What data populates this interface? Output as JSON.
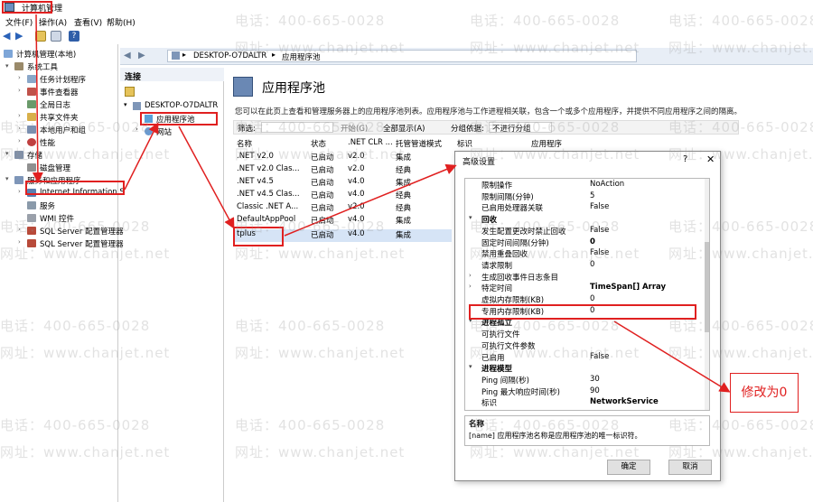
{
  "window": {
    "title": "计算机管理"
  },
  "menu": [
    "文件(F)",
    "操作(A)",
    "查看(V)",
    "帮助(H)"
  ],
  "tree": {
    "root": "计算机管理(本地)",
    "system_tools": "系统工具",
    "task_scheduler": "任务计划程序",
    "event_viewer": "事件查看器",
    "full_log": "全局日志",
    "shared_folders": "共享文件夹",
    "local_users": "本地用户和组",
    "performance": "性能",
    "storage": "存储",
    "disk_mgmt": "磁盘管理",
    "services_apps": "服务和应用程序",
    "iis": "Internet Information S",
    "services": "服务",
    "wmi": "WMI 控件",
    "sql_config1": "SQL Server 配置管理器",
    "sql_config2": "SQL Server 配置管理器"
  },
  "address": {
    "server": "DESKTOP-O7DALTR",
    "node": "应用程序池"
  },
  "connections": {
    "header": "连接",
    "server": "DESKTOP-O7DALTR",
    "app_pools": "应用程序池",
    "sites": "网站"
  },
  "main": {
    "title": "应用程序池",
    "description": "您可以在此页上查看和管理服务器上的应用程序池列表。应用程序池与工作进程相关联，包含一个或多个应用程序，并提供不同应用程序之间的隔离。",
    "filter_label": "筛选:",
    "start_btn": "开始(G)",
    "show_all_btn": "全部显示(A)",
    "group_by_label": "分组依据:",
    "group_by_value": "不进行分组",
    "columns": [
      "名称",
      "状态",
      ".NET CLR ...",
      "托管管道模式",
      "标识",
      "应用程序"
    ],
    "rows": [
      {
        "name": ".NET v2.0",
        "status": "已启动",
        "clr": "v2.0",
        "mode": "集成"
      },
      {
        "name": ".NET v2.0 Clas...",
        "status": "已启动",
        "clr": "v2.0",
        "mode": "经典"
      },
      {
        "name": ".NET v4.5",
        "status": "已启动",
        "clr": "v4.0",
        "mode": "集成"
      },
      {
        "name": ".NET v4.5 Clas...",
        "status": "已启动",
        "clr": "v4.0",
        "mode": "经典"
      },
      {
        "name": "Classic .NET A...",
        "status": "已启动",
        "clr": "v2.0",
        "mode": "经典"
      },
      {
        "name": "DefaultAppPool",
        "status": "已启动",
        "clr": "v4.0",
        "mode": "集成"
      },
      {
        "name": "tplus",
        "status": "已启动",
        "clr": "v4.0",
        "mode": "集成"
      }
    ]
  },
  "dialog": {
    "title": "高级设置",
    "close": "✕",
    "props": [
      {
        "type": "prop",
        "name": "限制操作",
        "value": "NoAction"
      },
      {
        "type": "prop",
        "name": "限制间隔(分钟)",
        "value": "5"
      },
      {
        "type": "prop",
        "name": "已启用处理器关联",
        "value": "False"
      },
      {
        "type": "cat",
        "name": "回收"
      },
      {
        "type": "prop",
        "name": "发生配置更改时禁止回收",
        "value": "False"
      },
      {
        "type": "prop",
        "name": "固定时间间隔(分钟)",
        "value": "0"
      },
      {
        "type": "prop",
        "name": "禁用重叠回收",
        "value": "False"
      },
      {
        "type": "prop",
        "name": "请求限制",
        "value": "0"
      },
      {
        "type": "sub",
        "name": "生成回收事件日志条目",
        "value": ""
      },
      {
        "type": "sub",
        "name": "特定时间",
        "value": "TimeSpan[] Array"
      },
      {
        "type": "prop",
        "name": "虚拟内存限制(KB)",
        "value": "0"
      },
      {
        "type": "prop",
        "name": "专用内存限制(KB)",
        "value": "0"
      },
      {
        "type": "cat",
        "name": "进程孤立"
      },
      {
        "type": "prop",
        "name": "可执行文件",
        "value": ""
      },
      {
        "type": "prop",
        "name": "可执行文件参数",
        "value": ""
      },
      {
        "type": "prop",
        "name": "已启用",
        "value": "False"
      },
      {
        "type": "cat",
        "name": "进程模型"
      },
      {
        "type": "prop",
        "name": "Ping 间隔(秒)",
        "value": "30"
      },
      {
        "type": "prop",
        "name": "Ping 最大响应时间(秒)",
        "value": "90"
      },
      {
        "type": "prop",
        "name": "标识",
        "value": "NetworkService"
      }
    ],
    "desc_title": "名称",
    "desc_text": "[name] 应用程序池名称是应用程序池的唯一标识符。",
    "ok": "确定",
    "cancel": "取消"
  },
  "annotation": {
    "callout": "修改为0"
  },
  "watermark": {
    "phone": "电话：400-665-0028",
    "site": "网址：www.chanjet.net"
  },
  "colors": {
    "annotation_red": "#e02020",
    "selection_blue": "#d6e4f6"
  }
}
